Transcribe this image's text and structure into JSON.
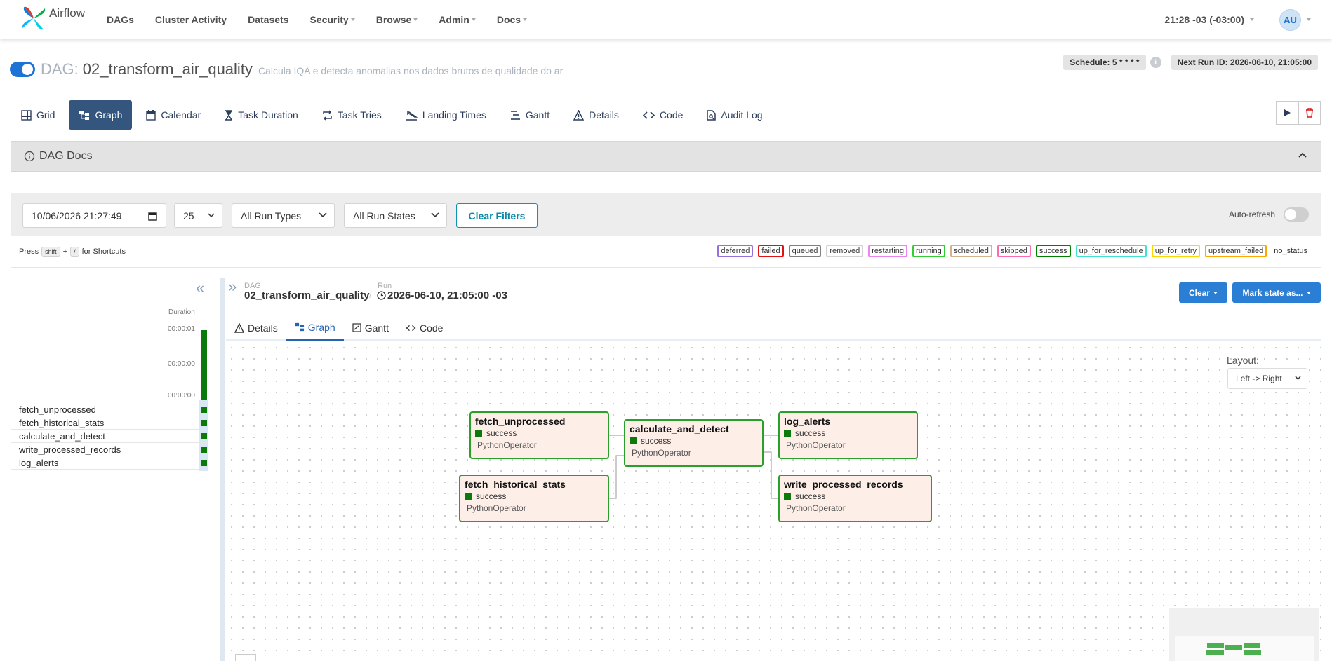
{
  "navbar": {
    "brand": "Airflow",
    "items": [
      {
        "label": "DAGs",
        "dropdown": false
      },
      {
        "label": "Cluster Activity",
        "dropdown": false
      },
      {
        "label": "Datasets",
        "dropdown": false
      },
      {
        "label": "Security",
        "dropdown": true
      },
      {
        "label": "Browse",
        "dropdown": true
      },
      {
        "label": "Admin",
        "dropdown": true
      },
      {
        "label": "Docs",
        "dropdown": true
      }
    ],
    "clock": "21:28 -03 (-03:00)",
    "user_initials": "AU"
  },
  "dag": {
    "label": "DAG:",
    "id": "02_transform_air_quality",
    "description": "Calcula IQA e detecta anomalias nos dados brutos de qualidade do ar",
    "schedule": "Schedule: 5 * * * *",
    "info_glyph": "i",
    "next_run": "Next Run ID: 2026-06-10, 21:05:00"
  },
  "tabs": [
    {
      "label": "Grid",
      "icon": "grid-icon"
    },
    {
      "label": "Graph",
      "icon": "graph-icon",
      "active": true
    },
    {
      "label": "Calendar",
      "icon": "calendar-icon"
    },
    {
      "label": "Task Duration",
      "icon": "hourglass-icon"
    },
    {
      "label": "Task Tries",
      "icon": "retry-icon"
    },
    {
      "label": "Landing Times",
      "icon": "landing-icon"
    },
    {
      "label": "Gantt",
      "icon": "gantt-icon"
    },
    {
      "label": "Details",
      "icon": "warning-icon"
    },
    {
      "label": "Code",
      "icon": "code-icon"
    },
    {
      "label": "Audit Log",
      "icon": "audit-icon"
    }
  ],
  "docs": {
    "label": "DAG Docs"
  },
  "filters": {
    "date_value": "10/06/2026 21:27:49",
    "count": "25",
    "run_types": "All Run Types",
    "run_states": "All Run States",
    "clear_label": "Clear Filters",
    "auto_refresh": "Auto-refresh"
  },
  "shortcuts": {
    "press": "Press",
    "key1": "shift",
    "plus": "+",
    "key2": "/",
    "suffix": "for Shortcuts"
  },
  "legend": [
    {
      "label": "deferred",
      "color": "#9370db"
    },
    {
      "label": "failed",
      "color": "#dc1414"
    },
    {
      "label": "queued",
      "color": "#808080"
    },
    {
      "label": "removed",
      "color": "#d3d3d3"
    },
    {
      "label": "restarting",
      "color": "#ee82ee"
    },
    {
      "label": "running",
      "color": "#32cd32"
    },
    {
      "label": "scheduled",
      "color": "#d2b48c"
    },
    {
      "label": "skipped",
      "color": "#ff69b4"
    },
    {
      "label": "success",
      "color": "#008000"
    },
    {
      "label": "up_for_reschedule",
      "color": "#40e0d0"
    },
    {
      "label": "up_for_retry",
      "color": "#ffd700"
    },
    {
      "label": "upstream_failed",
      "color": "#ffa500"
    },
    {
      "label": "no_status",
      "color": "transparent"
    }
  ],
  "grid": {
    "duration_label": "Duration",
    "ticks": [
      "00:00:01",
      "00:00:00",
      "00:00:00"
    ],
    "tasks": [
      "fetch_unprocessed",
      "fetch_historical_stats",
      "calculate_and_detect",
      "write_processed_records",
      "log_alerts"
    ]
  },
  "run_header": {
    "dag_small": "DAG",
    "dag_id": "02_transform_air_quality",
    "sep": "/",
    "run_small": "Run",
    "run_id": "2026-06-10, 21:05:00 -03",
    "clear_btn": "Clear",
    "mark_btn": "Mark state as..."
  },
  "subtabs": [
    {
      "label": "Details",
      "icon": "warning-icon"
    },
    {
      "label": "Graph",
      "icon": "graph-icon",
      "active": true
    },
    {
      "label": "Gantt",
      "icon": "gantt-icon"
    },
    {
      "label": "Code",
      "icon": "code-icon"
    }
  ],
  "graph": {
    "layout_label": "Layout:",
    "layout_value": "Left -> Right",
    "nodes": [
      {
        "id": "fetch_unprocessed",
        "state": "success",
        "operator": "PythonOperator"
      },
      {
        "id": "fetch_historical_stats",
        "state": "success",
        "operator": "PythonOperator"
      },
      {
        "id": "calculate_and_detect",
        "state": "success",
        "operator": "PythonOperator"
      },
      {
        "id": "log_alerts",
        "state": "success",
        "operator": "PythonOperator"
      },
      {
        "id": "write_processed_records",
        "state": "success",
        "operator": "PythonOperator"
      }
    ]
  },
  "colors": {
    "accent": "#34557d",
    "success": "#008000",
    "node_bg": "#fdeee8",
    "primary_btn": "#2a7ed3"
  }
}
